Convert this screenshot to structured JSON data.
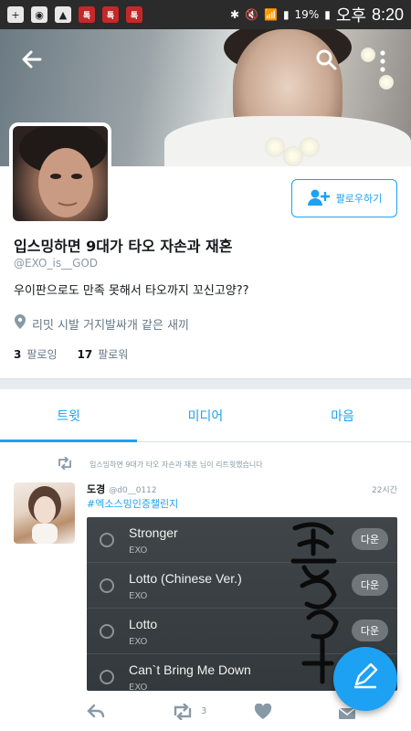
{
  "status_bar": {
    "battery": "19%",
    "ampm": "오후",
    "time": "8:20"
  },
  "profile": {
    "display_name": "입스밍하면 9대가 타오 자손과 재혼",
    "handle": "@EXO_is__GOD",
    "bio": "우이판으로도 만족 못해서 타오까지 꼬신고양??",
    "location": "리밋 시발 거지발싸개 같은 새끼",
    "following_count": "3",
    "following_label": "팔로잉",
    "followers_count": "17",
    "followers_label": "팔로워",
    "follow_button_label": "팔로우하기"
  },
  "tabs": [
    {
      "label": "트윗",
      "active": true
    },
    {
      "label": "미디어",
      "active": false
    },
    {
      "label": "마음",
      "active": false
    }
  ],
  "tweet": {
    "retweet_note": "입스밍하면 9대가 타오 자손과 재혼 님이 리트윗했습니다",
    "author_name": "도경",
    "author_handle": "@d0__0112",
    "time": "22시간",
    "hashtag": "#엑소스밍인증챌린지",
    "retweet_count": "3",
    "songs": [
      {
        "title": "Stronger",
        "artist": "EXO",
        "button": "다운"
      },
      {
        "title": "Lotto (Chinese Ver.)",
        "artist": "EXO",
        "button": "다운"
      },
      {
        "title": "Lotto",
        "artist": "EXO",
        "button": "다운"
      },
      {
        "title": "Can`t Bring Me Down",
        "artist": "EXO",
        "button": ""
      }
    ]
  },
  "colors": {
    "accent": "#1da1f2",
    "status_bar": "#2b2b2b",
    "divider": "#e6ecf0"
  },
  "icons": [
    "back-arrow-icon",
    "search-icon",
    "more-vertical-icon",
    "add-person-icon",
    "location-pin-icon",
    "retweet-icon",
    "reply-icon",
    "heart-icon",
    "message-icon",
    "compose-icon"
  ]
}
